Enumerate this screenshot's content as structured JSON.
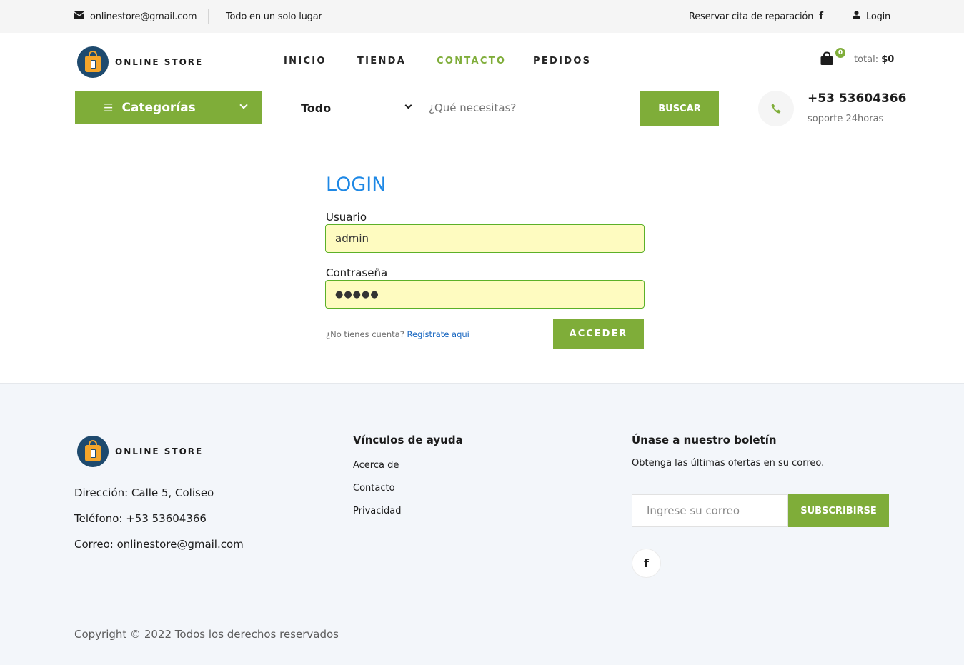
{
  "topbar": {
    "email": "onlinestore@gmail.com",
    "tagline": "Todo en un solo lugar",
    "repair": "Reservar cita de reparación",
    "login": "Login"
  },
  "brand": {
    "name": "ONLINE STORE"
  },
  "nav": [
    "INICIO",
    "TIENDA",
    "CONTACTO",
    "PEDIDOS"
  ],
  "nav_active": "CONTACTO",
  "cart": {
    "count": "0",
    "total_label": "total:",
    "total_value": "$0"
  },
  "categories": {
    "label": "Categorías"
  },
  "search": {
    "category": "Todo",
    "placeholder": "¿Qué necesitas?",
    "button": "BUSCAR"
  },
  "support": {
    "phone": "+53 53604366",
    "subtitle": "soporte 24horas"
  },
  "login_form": {
    "title": "LOGIN",
    "user_label": "Usuario",
    "user_value": "admin",
    "pass_label": "Contraseña",
    "pass_value": "●●●●●",
    "no_account": "¿No tienes cuenta?",
    "register_link": "Regístrate aquí",
    "submit": "ACCEDER"
  },
  "footer": {
    "address": "Dirección: Calle 5, Coliseo",
    "phone": "Teléfono: +53 53604366",
    "email": "Correo: onlinestore@gmail.com",
    "help_title": "Vínculos de ayuda",
    "help_links": [
      "Acerca de",
      "Contacto",
      "Privacidad"
    ],
    "newsletter_title": "Únase a nuestro boletín",
    "newsletter_text": "Obtenga las últimas ofertas en su correo.",
    "newsletter_placeholder": "Ingrese su correo",
    "newsletter_button": "SUBSCRIBIRSE",
    "copyright": "Copyright © 2022 Todos los derechos reservados"
  },
  "colors": {
    "accent": "#7fad39",
    "link": "#1e88e5",
    "footer_bg": "#f3f6fa"
  }
}
